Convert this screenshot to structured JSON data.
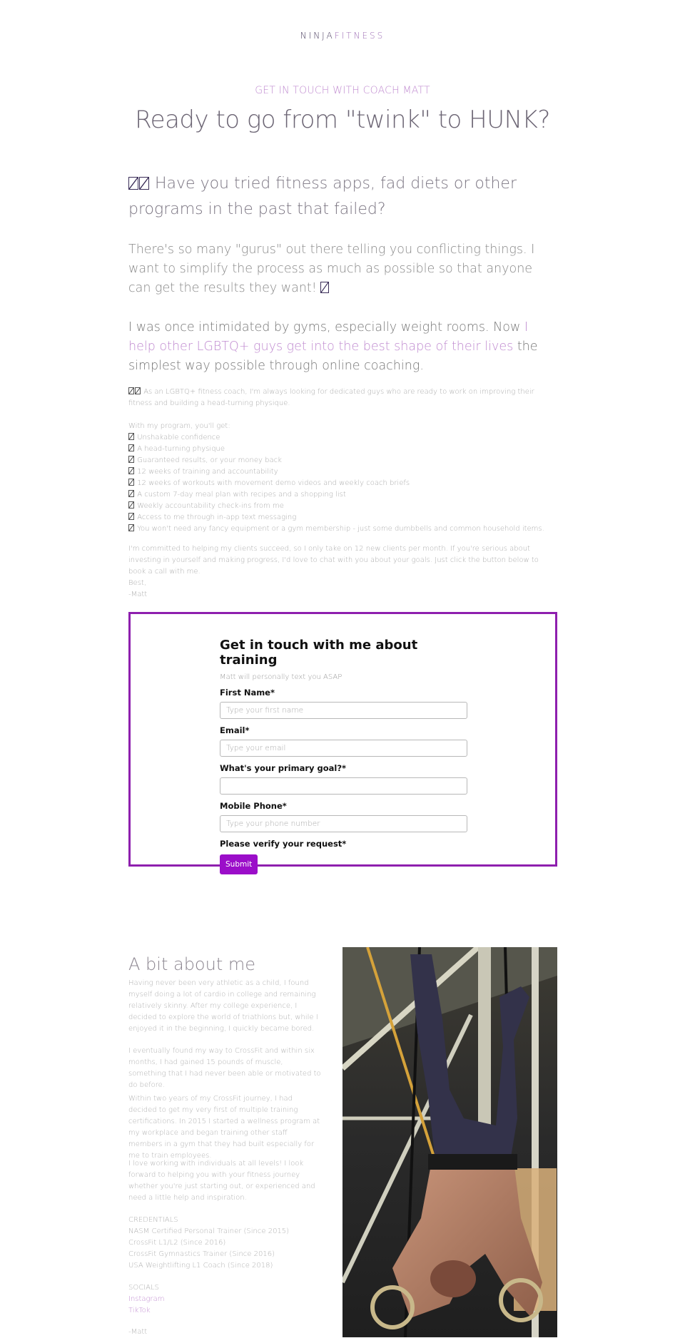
{
  "logo": {
    "part1": "NINJA",
    "part2": "FITNESS"
  },
  "hero": {
    "eyebrow": "GET IN TOUCH WITH COACH MATT",
    "headline": "Ready to go from \"twink\" to HUNK?"
  },
  "intro": {
    "question": "Have you tried fitness apps, fad diets or other programs in the past that failed?",
    "para1": "There's so many \"gurus\" out there telling you conflicting things. I want to simplify the process as much as possible so that anyone can get the results they want!",
    "para2_before": "I was once intimidated by gyms, especially weight rooms. Now ",
    "para2_highlight": "I help other LGBTQ+ guys get into the best shape of their lives",
    "para2_after": " the simplest way possible through online coaching."
  },
  "details": {
    "intro": "As an LGBTQ+ fitness coach, I'm always looking for dedicated guys who are ready to work on improving their fitness and building a head-turning physique.",
    "list_heading": "With my program, you'll get:",
    "benefits": [
      "Unshakable confidence",
      "A head-turning physique",
      "Guaranteed results, or your money back",
      "12 weeks of training and accountability",
      "12 weeks of workouts with movement demo videos and weekly coach briefs",
      "A custom 7-day meal plan with recipes and a shopping list",
      "Weekly accountability check-ins from me",
      "Access to me through in-app text messaging",
      "You won't need any fancy equipment or a gym membership - just some dumbbells and common household items."
    ],
    "commitment": "I'm committed to helping my clients succeed, so I only take on 12 new clients per month. If you're serious about investing in yourself and making progress, I'd love to chat with you about your goals. Just click the button below to book a call with me.",
    "signoff1": "Best,",
    "signoff2": "-Matt"
  },
  "form": {
    "title": "Get in touch with me about training",
    "subtitle": "Matt will personally text you ASAP",
    "fields": [
      {
        "label": "First Name*",
        "placeholder": "Type your first name",
        "value": ""
      },
      {
        "label": "Email*",
        "placeholder": "Type your email",
        "value": ""
      },
      {
        "label": "What's your primary goal?*",
        "placeholder": "",
        "value": ""
      },
      {
        "label": "Mobile Phone*",
        "placeholder": "Type your phone number",
        "value": ""
      }
    ],
    "verify_label": "Please verify your request*",
    "submit_label": "Submit",
    "accent_color": "#9b0ec9",
    "border_color": "#8e1fae"
  },
  "about": {
    "title": "A bit about me",
    "paragraphs": [
      "Having never been very athletic as a child, I found myself doing a lot of cardio in college and remaining relatively skinny. After my college experience, I decided to explore the world of triathlons but, while I enjoyed it in the beginning, I quickly became bored.",
      "I eventually found my way to CrossFit and within six months, I had gained 15 pounds of muscle, something that I had never been able or motivated to do before.",
      "Within two years of my CrossFit journey, I had decided to get my very first of multiple training certifications. In 2015 I started a wellness program at my workplace and began training other staff members in a gym that they had built especially for me to train employees.",
      "I love working with individuals at all levels! I look forward to helping you with your fitness journey whether you're just starting out, or experienced and need a little help and inspiration."
    ],
    "credentials_heading": "CREDENTIALS",
    "credentials": [
      "NASM Certified Personal Trainer (Since 2015)",
      "CrossFit L1/L2 (Since 2016)",
      "CrossFit Gymnastics Trainer (Since 2016)",
      "USA Weightlifting L1 Coach (Since 2018)"
    ],
    "socials_heading": "SOCIALS",
    "socials": [
      "Instagram",
      "TikTok"
    ],
    "signature": "-Matt",
    "photo_alt": "Coach Matt hanging upside down on gymnastics rings in a gym"
  },
  "colors": {
    "accent_pink": "#c08bd0",
    "heading_gray": "#6c6574"
  }
}
